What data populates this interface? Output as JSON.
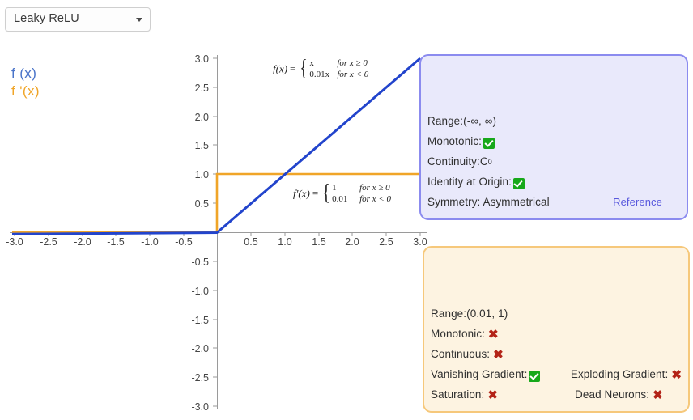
{
  "selector": {
    "value": "Leaky ReLU",
    "caret_icon": "chevron-down-icon"
  },
  "legend": {
    "function_label": "f (x)",
    "derivative_label": "f '(x)",
    "function_color": "#2244cc",
    "derivative_color": "#f0a528"
  },
  "formulas": {
    "function": {
      "lhs": "f(x)",
      "eq": "=",
      "cases": [
        {
          "value": "x",
          "condition": "for x ≥ 0"
        },
        {
          "value": "0.01x",
          "condition": "for x < 0"
        }
      ]
    },
    "derivative": {
      "lhs": "f'(x)",
      "eq": "=",
      "cases": [
        {
          "value": "1",
          "condition": "for x ≥ 0"
        },
        {
          "value": "0.01",
          "condition": "for x < 0"
        }
      ]
    }
  },
  "chart_data": {
    "type": "line",
    "title": "",
    "xlabel": "",
    "ylabel": "",
    "xlim": [
      -3.0,
      3.0
    ],
    "ylim": [
      -3.0,
      3.0
    ],
    "grid": false,
    "legend_position": "top-left-outside",
    "xticks": [
      "-3.0",
      "-2.5",
      "-2.0",
      "-1.5",
      "-1.0",
      "-0.5",
      "0.5",
      "1.0",
      "1.5",
      "2.0",
      "2.5",
      "3.0"
    ],
    "yticks": [
      "3.0",
      "2.5",
      "2.0",
      "1.5",
      "1.0",
      "0.5",
      "-0.5",
      "-1.0",
      "-1.5",
      "-2.0",
      "-2.5",
      "-3.0"
    ],
    "series": [
      {
        "name": "f (x)",
        "color": "#2244cc",
        "x": [
          -3.0,
          0.0,
          3.0
        ],
        "y": [
          -0.03,
          0.0,
          3.0
        ]
      },
      {
        "name": "f '(x)",
        "color": "#f0a528",
        "x": [
          -3.0,
          0.0,
          0.0,
          3.0
        ],
        "y": [
          0.01,
          0.01,
          1.0,
          1.0
        ]
      }
    ]
  },
  "function_panel": {
    "accent_color": "#8b8bef",
    "background_color": "#e9e9fb",
    "rows": [
      {
        "label": "Range:(-∞, ∞)",
        "mark": "none"
      },
      {
        "label": "Monotonic:",
        "mark": "yes"
      },
      {
        "label": "Continuity:C",
        "sup": "0",
        "mark": "none"
      },
      {
        "label": "Identity at Origin:",
        "mark": "yes"
      },
      {
        "label": "Symmetry: Asymmetrical",
        "mark": "none"
      }
    ],
    "reference_label": "Reference"
  },
  "derivative_panel": {
    "accent_color": "#f6c87b",
    "background_color": "#fdf3e1",
    "rows": [
      {
        "label": "Range:(0.01, 1)",
        "mark": "none"
      },
      {
        "label": "Monotonic:",
        "mark": "no"
      },
      {
        "label": "Continuous:",
        "mark": "no"
      },
      {
        "label": "Vanishing Gradient:",
        "mark": "yes",
        "right_label": "Exploding Gradient:",
        "right_mark": "no"
      },
      {
        "label": "Saturation:",
        "mark": "no",
        "right_label": "Dead Neurons:",
        "right_mark": "no"
      }
    ]
  },
  "marks": {
    "yes_icon": "check-mark-icon",
    "no_icon": "cross-mark-icon",
    "no_glyph": "✖"
  }
}
